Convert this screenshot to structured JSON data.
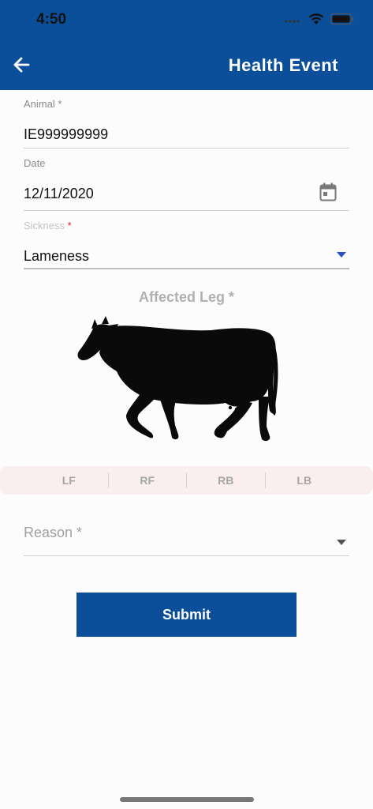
{
  "status": {
    "time": "4:50"
  },
  "header": {
    "title": "Health Event"
  },
  "form": {
    "animal": {
      "label": "Animal",
      "required_mark": "*",
      "value": "IE999999999"
    },
    "date": {
      "label": "Date",
      "value": "12/11/2020"
    },
    "sickness": {
      "label": "Sickness",
      "required_mark": "*",
      "value": "Lameness"
    },
    "affected_leg": {
      "title": "Affected Leg *",
      "legs": [
        "LF",
        "RF",
        "RB",
        "LB"
      ]
    },
    "reason": {
      "label": "Reason *",
      "value": ""
    },
    "submit_label": "Submit"
  },
  "colors": {
    "brand": "#0b4f9a",
    "leg_bar_bg": "#fbeeee",
    "required_red": "#e02020",
    "dropdown_accent": "#2b4fc4"
  },
  "icons": {
    "back": "arrow-left-icon",
    "calendar": "calendar-icon",
    "dropdown": "chevron-down-icon",
    "cow": "cow-silhouette-icon"
  }
}
